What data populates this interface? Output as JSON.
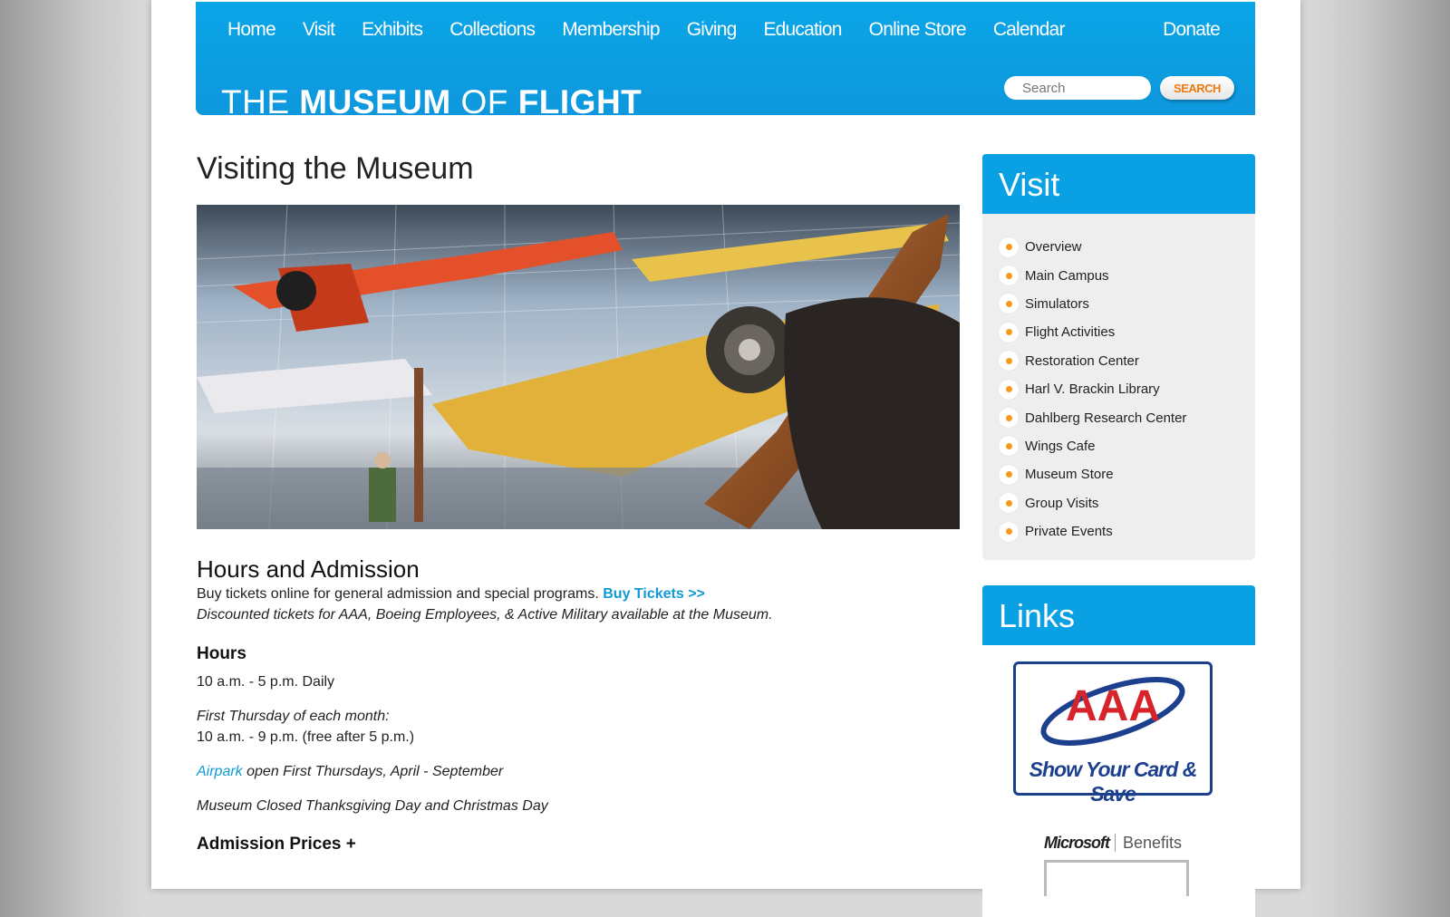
{
  "header": {
    "nav": [
      "Home",
      "Visit",
      "Exhibits",
      "Collections",
      "Membership",
      "Giving",
      "Education",
      "Online Store",
      "Calendar"
    ],
    "donate": "Donate",
    "logo": {
      "the": "THE ",
      "museum": "MUSEUM",
      "of": " OF ",
      "flight": "FLIGHT"
    },
    "search_placeholder": "Search",
    "search_button": "SEARCH"
  },
  "main": {
    "title": "Visiting the Museum",
    "section_title": "Hours and Admission",
    "buy_text": "Buy tickets online for general admission and special programs.",
    "buy_link": "Buy Tickets >>",
    "discount_text": "Discounted tickets for AAA, Boeing Employees, & Active Military available at the Museum.",
    "hours_heading": "Hours",
    "hours_daily": "10 a.m. - 5 p.m. Daily",
    "first_thursday_label": "First Thursday of each month:",
    "first_thursday_hours": "10 a.m. - 9 p.m. (free after 5 p.m.)",
    "airpark_link": "Airpark",
    "airpark_text": " open First Thursdays, April - September",
    "closed_text": "Museum Closed Thanksgiving Day and Christmas Day",
    "admission_heading": "Admission Prices +"
  },
  "sidebar": {
    "visit_title": "Visit",
    "visit_items": [
      "Overview",
      "Main Campus",
      "Simulators",
      "Flight Activities",
      "Restoration Center",
      "Harl V. Brackin Library",
      "Dahlberg Research Center",
      "Wings Cafe",
      "Museum Store",
      "Group Visits",
      "Private Events"
    ],
    "links_title": "Links",
    "aaa_logo_text": "AAA",
    "aaa_tagline": "Show Your Card & Save",
    "ms_brand": "Microsoft",
    "ms_benefits": "Benefits"
  },
  "colors": {
    "brand_blue": "#0aa6e8",
    "accent_orange": "#f59a1b",
    "link_blue": "#0f9ad6"
  }
}
